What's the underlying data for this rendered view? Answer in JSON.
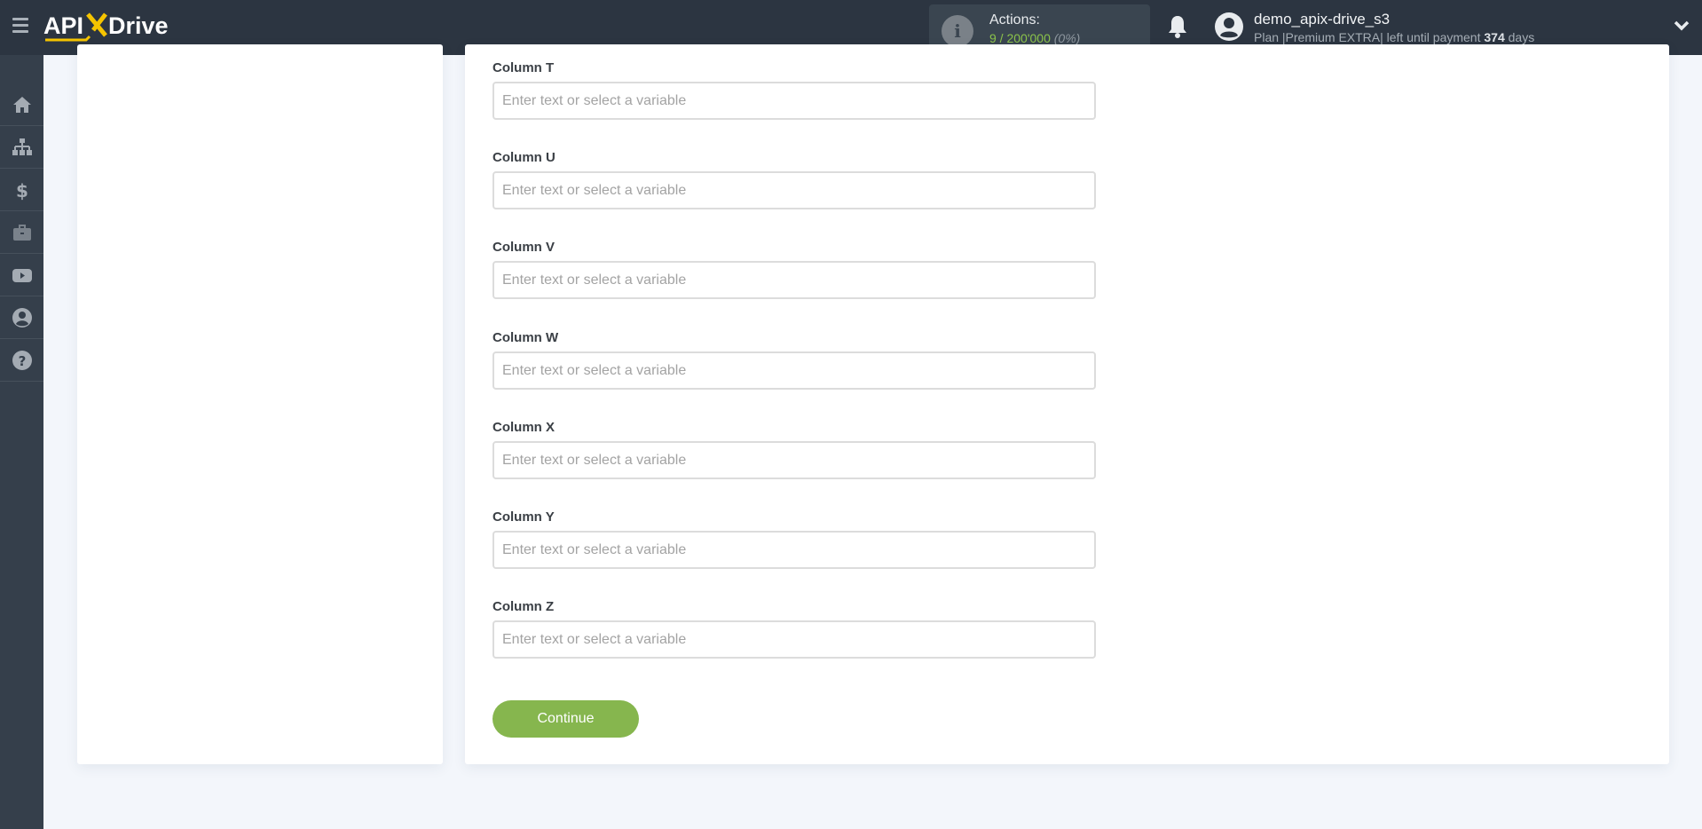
{
  "header": {
    "logo_text": "APIXDrive",
    "actions_label": "Actions:",
    "actions_used": "9",
    "actions_separator": " / ",
    "actions_total": "200'000",
    "actions_percent": "(0%)",
    "user_name": "demo_apix-drive_s3",
    "plan_prefix": "Plan |Premium EXTRA| left until payment ",
    "plan_days": "374",
    "plan_suffix": " days"
  },
  "sidebar": {
    "items": [
      {
        "icon": "home-icon",
        "label": "Home"
      },
      {
        "icon": "sitemap-icon",
        "label": "Connections"
      },
      {
        "icon": "dollar-icon",
        "label": "Billing"
      },
      {
        "icon": "briefcase-icon",
        "label": "Services"
      },
      {
        "icon": "youtube-icon",
        "label": "Videos"
      },
      {
        "icon": "user-circle-icon",
        "label": "Account"
      },
      {
        "icon": "question-circle-icon",
        "label": "Help"
      }
    ]
  },
  "form": {
    "fields": [
      {
        "label": "Column T",
        "placeholder": "Enter text or select a variable",
        "value": ""
      },
      {
        "label": "Column U",
        "placeholder": "Enter text or select a variable",
        "value": ""
      },
      {
        "label": "Column V",
        "placeholder": "Enter text or select a variable",
        "value": ""
      },
      {
        "label": "Column W",
        "placeholder": "Enter text or select a variable",
        "value": ""
      },
      {
        "label": "Column X",
        "placeholder": "Enter text or select a variable",
        "value": ""
      },
      {
        "label": "Column Y",
        "placeholder": "Enter text or select a variable",
        "value": ""
      },
      {
        "label": "Column Z",
        "placeholder": "Enter text or select a variable",
        "value": ""
      }
    ],
    "continue_label": "Continue"
  },
  "colors": {
    "header_bg": "#2c3541",
    "sidebar_bg": "#353f4b",
    "accent_green": "#86b64e",
    "logo_yellow": "#f5c400"
  }
}
